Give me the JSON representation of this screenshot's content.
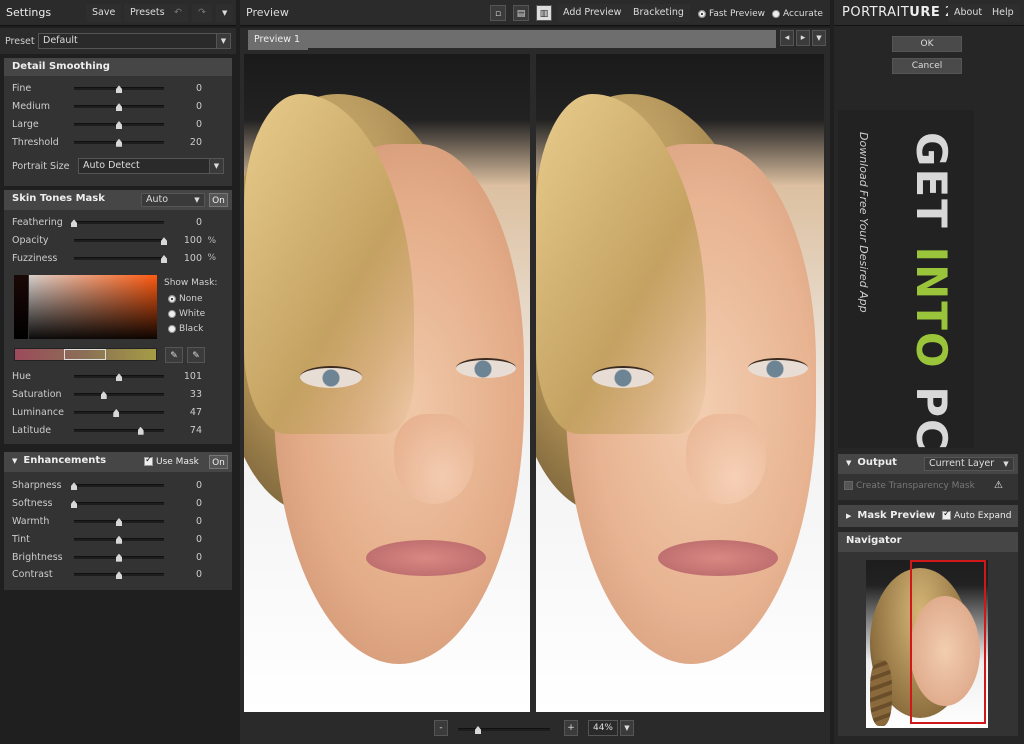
{
  "left": {
    "settings_title": "Settings",
    "save": "Save",
    "presets": "Presets",
    "preset_label": "Preset",
    "preset_value": "Default",
    "detail": {
      "title": "Detail Smoothing",
      "rows": [
        {
          "label": "Fine",
          "value": "0",
          "pos": 0.5
        },
        {
          "label": "Medium",
          "value": "0",
          "pos": 0.5
        },
        {
          "label": "Large",
          "value": "0",
          "pos": 0.5
        },
        {
          "label": "Threshold",
          "value": "20",
          "pos": 0.5
        }
      ],
      "portrait_size_label": "Portrait Size",
      "portrait_size_value": "Auto Detect"
    },
    "skin": {
      "title": "Skin Tones Mask",
      "mode": "Auto",
      "on": "On",
      "rows": [
        {
          "label": "Feathering",
          "value": "0",
          "unit": "",
          "pos": 0.0
        },
        {
          "label": "Opacity",
          "value": "100",
          "unit": "%",
          "pos": 1.0
        },
        {
          "label": "Fuzziness",
          "value": "100",
          "unit": "%",
          "pos": 1.0
        }
      ],
      "show_mask_label": "Show Mask:",
      "mask_options": [
        "None",
        "White",
        "Black"
      ],
      "rows2": [
        {
          "label": "Hue",
          "value": "101",
          "pos": 0.5
        },
        {
          "label": "Saturation",
          "value": "33",
          "pos": 0.33
        },
        {
          "label": "Luminance",
          "value": "47",
          "pos": 0.47
        },
        {
          "label": "Latitude",
          "value": "74",
          "pos": 0.74
        }
      ]
    },
    "enh": {
      "title": "Enhancements",
      "use_mask": "Use Mask",
      "on": "On",
      "rows": [
        {
          "label": "Sharpness",
          "value": "0",
          "pos": 0.0
        },
        {
          "label": "Softness",
          "value": "0",
          "pos": 0.0
        },
        {
          "label": "Warmth",
          "value": "0",
          "pos": 0.5
        },
        {
          "label": "Tint",
          "value": "0",
          "pos": 0.5
        },
        {
          "label": "Brightness",
          "value": "0",
          "pos": 0.5
        },
        {
          "label": "Contrast",
          "value": "0",
          "pos": 0.5
        }
      ]
    }
  },
  "center": {
    "preview_title": "Preview",
    "add_preview": "Add Preview",
    "bracketing": "Bracketing",
    "fast_preview": "Fast Preview",
    "accurate": "Accurate",
    "tab": "Preview 1",
    "zoom_minus": "-",
    "zoom_plus": "+",
    "zoom_value": "44%"
  },
  "right": {
    "app_title_a": "PORTRAIT",
    "app_title_b": "URE",
    "app_version": "2",
    "about": "About",
    "help": "Help",
    "ok": "OK",
    "cancel": "Cancel",
    "banner_a": "GET",
    "banner_b": "INTO",
    "banner_c": "PC",
    "banner_sub": "Download Free Your Desired App",
    "output_title": "Output",
    "output_value": "Current Layer",
    "create_transparency": "Create Transparency Mask",
    "mask_preview": "Mask Preview",
    "auto_expand": "Auto Expand",
    "navigator": "Navigator"
  },
  "colors": {
    "accent_green": "#9ac43a",
    "nav_frame": "#d01818"
  }
}
